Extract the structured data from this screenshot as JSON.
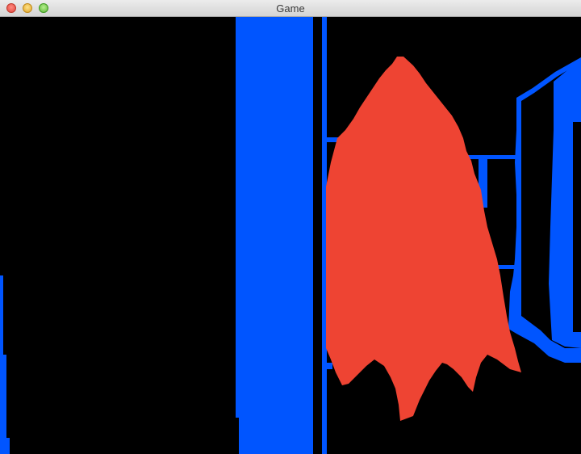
{
  "window": {
    "title": "Game"
  },
  "scene": {
    "background": "#000000",
    "wall_color": "#0055ff",
    "ghost_color": "#ee4433"
  }
}
